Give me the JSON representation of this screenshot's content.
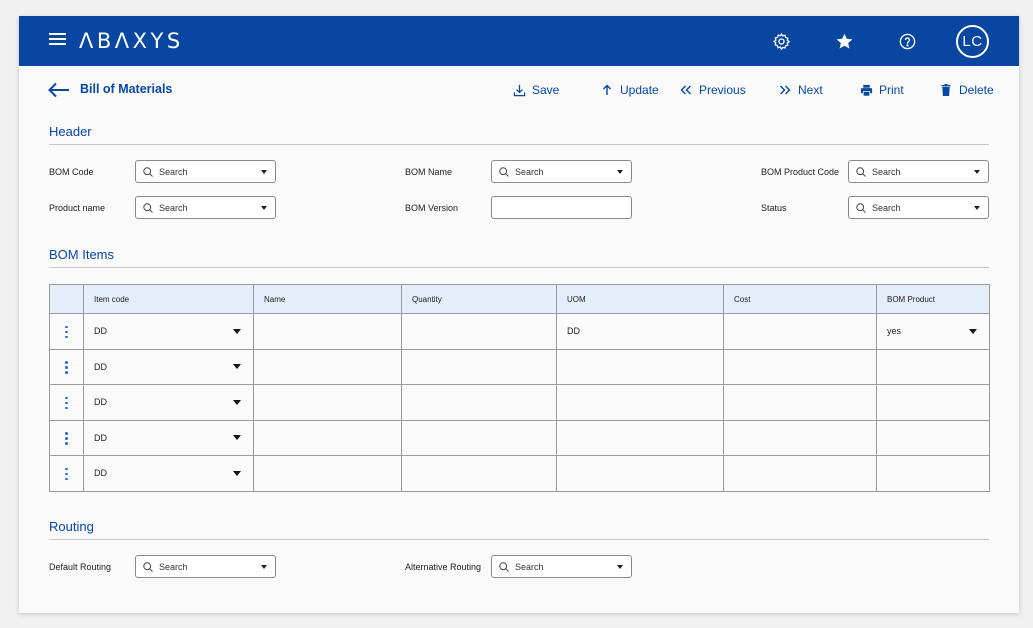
{
  "app": {
    "logo": "ΛBΛXYS",
    "avatar_initials": "LC"
  },
  "icons": {
    "menu": "hamburger-icon",
    "settings": "gear-icon",
    "favorite": "star-icon",
    "help": "question-circle-icon",
    "back": "arrow-left-icon"
  },
  "page": {
    "title": "Bill of Materials"
  },
  "toolbar": {
    "save": "Save",
    "update": "Update",
    "previous": "Previous",
    "next": "Next",
    "print": "Print",
    "delete": "Delete"
  },
  "header_section": {
    "title": "Header",
    "bom_code_label": "BOM Code",
    "bom_name_label": "BOM Name",
    "bom_product_code_label": "BOM Product Code",
    "product_name_label": "Product name",
    "bom_version_label": "BOM Version",
    "status_label": "Status",
    "search_placeholder": "Search"
  },
  "bom_items": {
    "title": "BOM Items",
    "columns": [
      "Item code",
      "Name",
      "Quantity",
      "UOM",
      "Cost",
      "BOM Product"
    ],
    "rows": [
      {
        "item_code": "DD",
        "name": "",
        "quantity": "",
        "uom": "DD",
        "cost": "",
        "bom_product": "yes"
      },
      {
        "item_code": "DD",
        "name": "",
        "quantity": "",
        "uom": "",
        "cost": "",
        "bom_product": ""
      },
      {
        "item_code": "DD",
        "name": "",
        "quantity": "",
        "uom": "",
        "cost": "",
        "bom_product": ""
      },
      {
        "item_code": "DD",
        "name": "",
        "quantity": "",
        "uom": "",
        "cost": "",
        "bom_product": ""
      },
      {
        "item_code": "DD",
        "name": "",
        "quantity": "",
        "uom": "",
        "cost": "",
        "bom_product": ""
      }
    ]
  },
  "routing": {
    "title": "Routing",
    "default_label": "Default Routing",
    "alternative_label": "Alternative Routing",
    "search_placeholder": "Search"
  },
  "colors": {
    "primary": "#0846a1",
    "table_header": "#e4eefb",
    "link": "#0846a1"
  }
}
